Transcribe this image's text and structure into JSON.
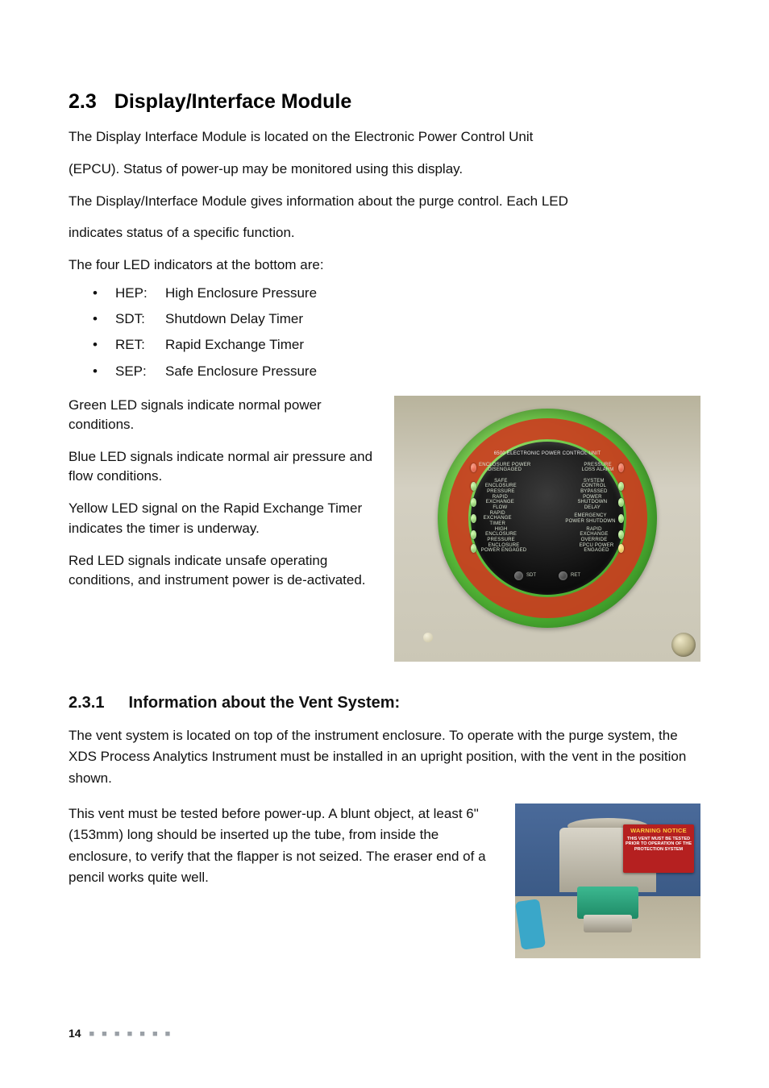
{
  "section": {
    "number": "2.3",
    "title": "Display/Interface Module"
  },
  "paragraphs": {
    "p1": "The Display Interface Module is located on the Electronic Power Control Unit",
    "p2": "(EPCU). Status of power-up may be monitored using this display.",
    "p3": "The Display/Interface Module gives information about the purge control. Each LED",
    "p4": "indicates status of a specific function.",
    "p5": "The four LED indicators at the bottom are:"
  },
  "led_list": [
    {
      "abbr": "HEP:",
      "desc": "High Enclosure Pressure"
    },
    {
      "abbr": "SDT:",
      "desc": "Shutdown Delay Timer"
    },
    {
      "abbr": "RET:",
      "desc": "Rapid Exchange Timer"
    },
    {
      "abbr": "SEP:",
      "desc": "Safe Enclosure Pressure"
    }
  ],
  "signals": {
    "green": "Green LED signals indicate normal power conditions.",
    "blue": "Blue LED signals indicate normal air pressure and flow conditions.",
    "yellow": "Yellow LED signal on the Rapid Exchange Timer indicates the timer is underway.",
    "red": "Red LED signals indicate unsafe operating conditions, and instrument power is de-activated."
  },
  "figure1": {
    "panel_title": "6500 ELECTRONIC POWER CONTROL UNIT",
    "labels_left": [
      "ENCLOSURE POWER DISENGAGED",
      "SAFE ENCLOSURE PRESSURE",
      "RAPID EXCHANGE FLOW",
      "RAPID EXCHANGE TIMER",
      "HIGH ENCLOSURE PRESSURE",
      "ENCLOSURE POWER ENGAGED"
    ],
    "labels_right": [
      "PRESSURE LOSS ALARM",
      "SYSTEM CONTROL BYPASSED",
      "POWER SHUTDOWN DELAY",
      "EMERGENCY POWER SHUTDOWN",
      "RAPID EXCHANGE OVERRIDE",
      "EPCU POWER ENGAGED"
    ],
    "bottom_labels": [
      "SDT",
      "RET"
    ]
  },
  "subsection": {
    "number": "2.3.1",
    "title": "Information about the Vent System:"
  },
  "vent": {
    "p1": "The vent system is located on top of the instrument enclosure. To operate with the purge system, the XDS Process Analytics Instrument must be installed in an upright position, with the vent in the position shown.",
    "p2": "This vent must be tested before power-up. A blunt object, at least 6\" (153mm) long should be inserted up the tube, from inside the enclosure, to verify that the flapper is not seized. The eraser end of a pencil works quite well."
  },
  "figure2": {
    "tag_title": "WARNING NOTICE",
    "tag_lines": "THIS VENT MUST BE TESTED PRIOR TO OPERATION OF THE PROTECTION SYSTEM"
  },
  "footer": {
    "page_number": "14",
    "dots": "■ ■ ■ ■ ■ ■ ■"
  }
}
